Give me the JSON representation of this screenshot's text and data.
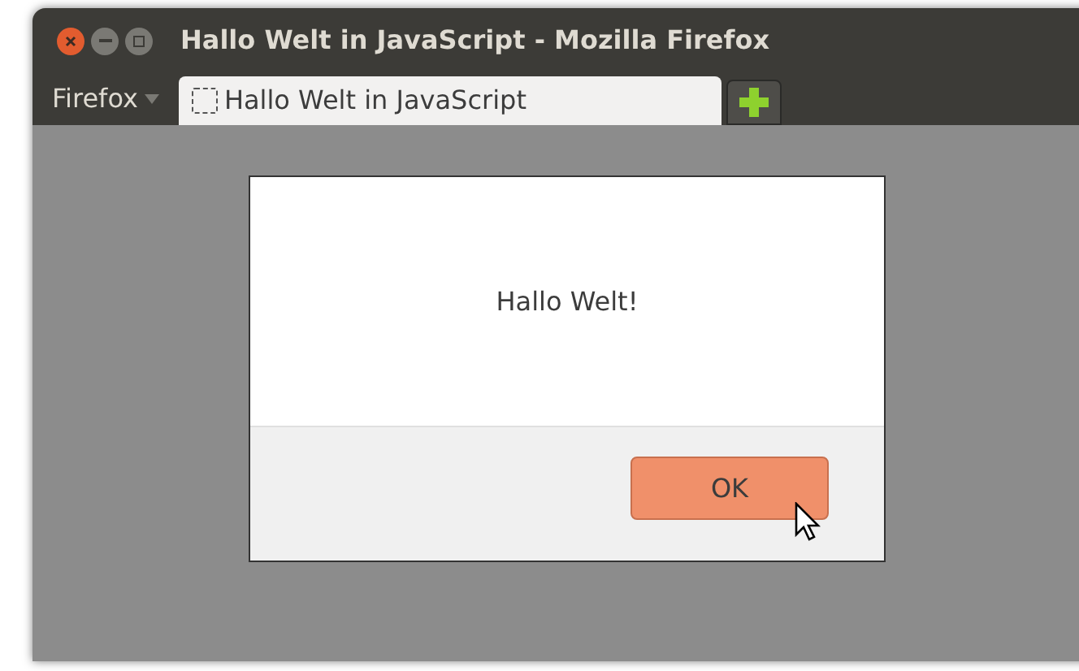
{
  "window": {
    "title": "Hallo Welt in JavaScript - Mozilla Firefox"
  },
  "menu_button": {
    "label": "Firefox"
  },
  "tabs": [
    {
      "label": "Hallo Welt in JavaScript",
      "selected": true
    }
  ],
  "dialog": {
    "message": "Hallo Welt!",
    "buttons": [
      {
        "label": "OK",
        "hovered": true
      }
    ]
  }
}
